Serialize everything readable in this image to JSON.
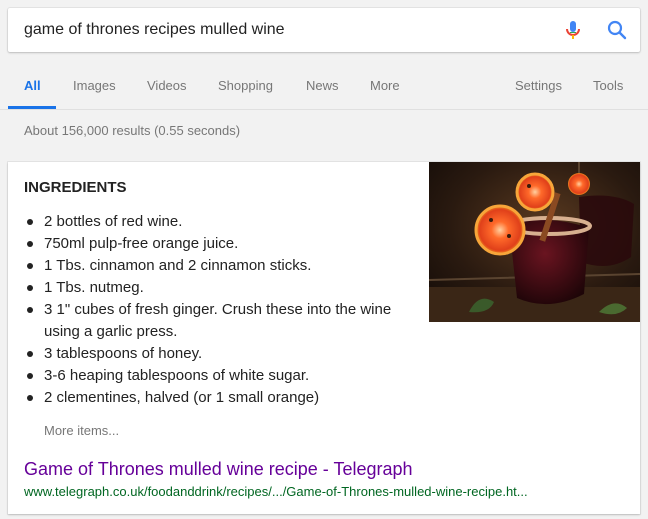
{
  "search": {
    "query": "game of thrones recipes mulled wine"
  },
  "tabs": [
    {
      "label": "All"
    },
    {
      "label": "Images"
    },
    {
      "label": "Videos"
    },
    {
      "label": "Shopping"
    },
    {
      "label": "News"
    },
    {
      "label": "More"
    },
    {
      "label": "Settings"
    },
    {
      "label": "Tools"
    }
  ],
  "result_stats": "About 156,000 results (0.55 seconds)",
  "snippet": {
    "heading": "INGREDIENTS",
    "items": [
      "2 bottles of red wine.",
      "750ml pulp-free orange juice.",
      "1 Tbs. cinnamon and 2 cinnamon sticks.",
      "1 Tbs. nutmeg.",
      "3 1\" cubes of fresh ginger. Crush these into the wine using a garlic press.",
      "3 tablespoons of honey.",
      "3-6 heaping tablespoons of white sugar.",
      "2 clementines, halved (or 1 small orange)"
    ],
    "more_items": "More items...",
    "title": "Game of Thrones mulled wine recipe - Telegraph",
    "url": "www.telegraph.co.uk/foodanddrink/recipes/.../Game-of-Thrones-mulled-wine-recipe.ht..."
  },
  "colors": {
    "accent": "#1a73e8",
    "visited_link": "#660099",
    "url_green": "#006621"
  }
}
